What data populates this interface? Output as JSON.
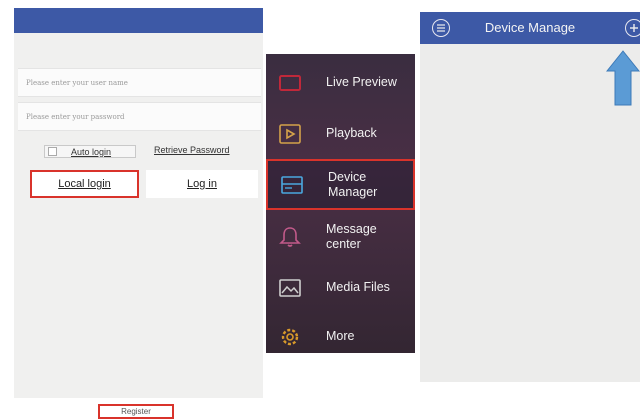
{
  "login": {
    "username_placeholder": "Please enter your user name",
    "password_placeholder": "Please enter your password",
    "auto_login": "Auto login",
    "retrieve_password": "Retrieve Password",
    "local_login": "Local login",
    "login": "Log in",
    "register": "Register"
  },
  "menu": {
    "items": [
      {
        "label": "Live Preview",
        "icon": "live-preview-icon"
      },
      {
        "label": "Playback",
        "icon": "playback-icon"
      },
      {
        "label": "Device\nManager",
        "icon": "device-manager-icon",
        "selected": true
      },
      {
        "label": "Message\ncenter",
        "icon": "bell-icon"
      },
      {
        "label": "Media Files",
        "icon": "media-files-icon"
      },
      {
        "label": "More",
        "icon": "gear-icon"
      }
    ]
  },
  "device": {
    "title": "Device Manage"
  },
  "colors": {
    "header_blue": "#3d59a6",
    "highlight_red": "#d9332b",
    "arrow_blue": "#5b9bd5",
    "menu_bg": "#3a2d40"
  }
}
